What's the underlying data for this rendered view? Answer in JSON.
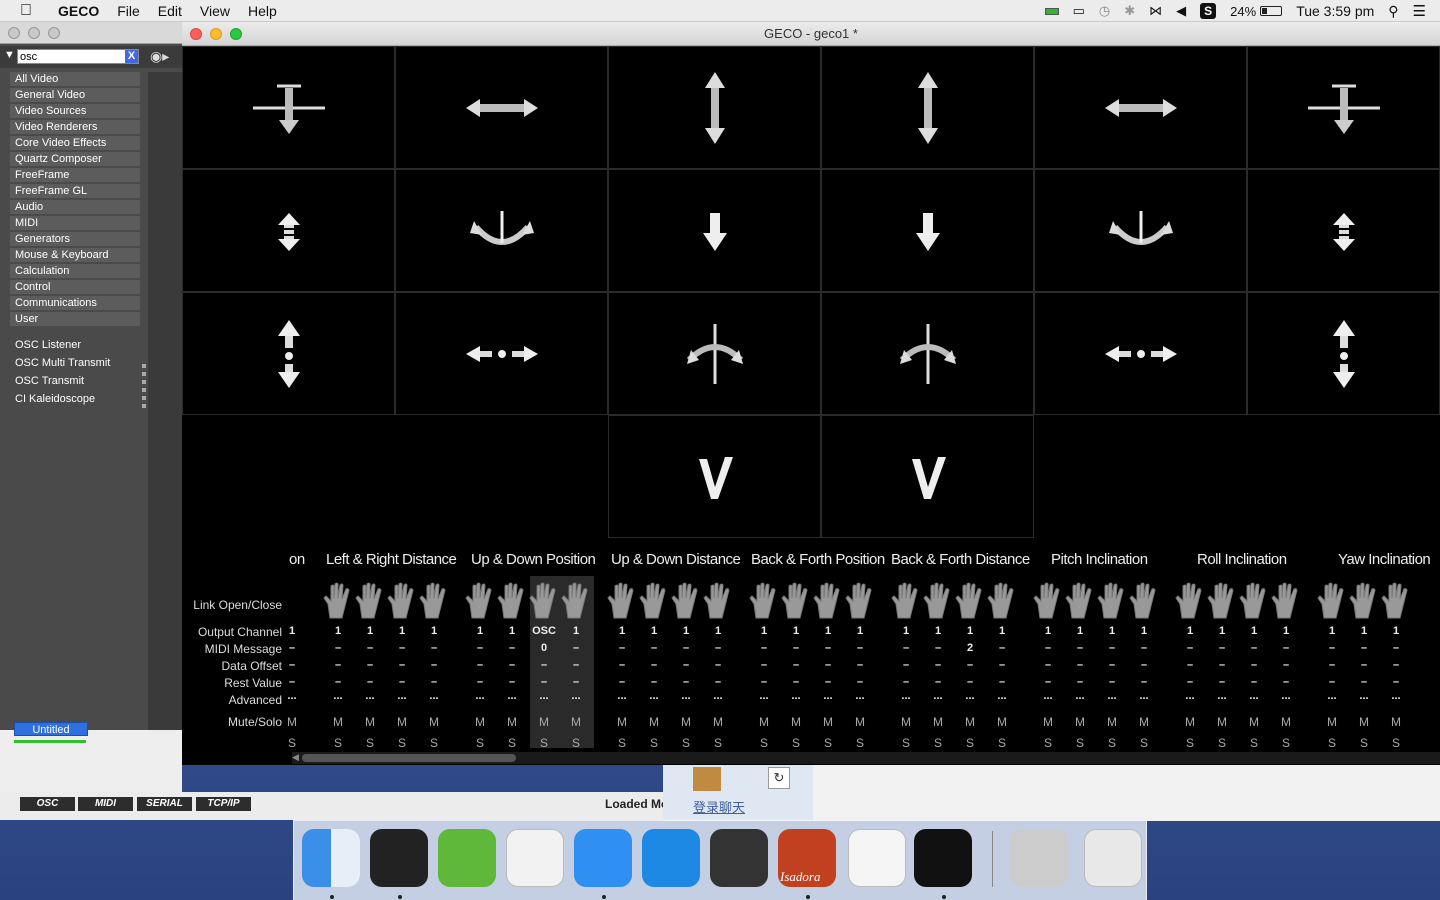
{
  "menubar": {
    "app_name": "GECO",
    "menus": [
      "File",
      "Edit",
      "View",
      "Help"
    ],
    "battery": "24%",
    "clock": "Tue 3:59 pm"
  },
  "left_panel": {
    "search_value": "osc",
    "search_clear": "X",
    "categories": [
      "All Video",
      "General Video",
      "Video Sources",
      "Video Renderers",
      "Core Video Effects",
      "Quartz Composer",
      "FreeFrame",
      "FreeFrame GL",
      "Audio",
      "MIDI",
      "Generators",
      "Mouse & Keyboard",
      "Calculation",
      "Control",
      "Communications",
      "User"
    ],
    "actors": [
      "OSC Listener",
      "OSC Multi Transmit",
      "OSC Transmit",
      "CI Kaleidoscope"
    ],
    "scene_name": "Untitled"
  },
  "statusbar": {
    "protocols": [
      "OSC",
      "MIDI",
      "SERIAL",
      "TCP/IP"
    ],
    "loaded_text": "Loaded Me",
    "chat_text": "登录聊天"
  },
  "main_window": {
    "title": "GECO - geco1 *"
  },
  "grid": {
    "icons": [
      [
        "cross-arrow",
        "horizontal-arrow",
        "vertical-arrow",
        "vertical-arrow",
        "horizontal-arrow",
        "cross-arrow"
      ],
      [
        "short-vertical-arrow",
        "roll-arc",
        "down-arrow",
        "down-arrow",
        "roll-arc",
        "short-vertical-arrow"
      ],
      [
        "vertical-dot-arrow",
        "horizontal-dot-arrow",
        "pitch-arc",
        "pitch-arc",
        "horizontal-dot-arrow",
        "vertical-dot-arrow"
      ],
      [
        "",
        "",
        "check",
        "check",
        "",
        ""
      ]
    ]
  },
  "controls": {
    "headers": [
      "on",
      "Left & Right Distance",
      "Up & Down Position",
      "Up & Down Distance",
      "Back & Forth Position",
      "Back & Forth Distance",
      "Pitch Inclination",
      "Roll Inclination",
      "Yaw Inclination"
    ],
    "row_labels": {
      "link": "Link Open/Close",
      "output": "Output Channel",
      "midi": "MIDI Message",
      "offset": "Data Offset",
      "rest": "Rest Value",
      "advanced": "Advanced",
      "mute": "Mute/Solo"
    },
    "selected_output": "OSC",
    "selected_midi": "0",
    "special_midi": "2",
    "channel_value": "1",
    "dash": "–",
    "dots": "...",
    "mute": "M",
    "solo": "S"
  },
  "dock": {
    "apps": [
      "Finder",
      "Unity",
      "Chronosync",
      "Slack",
      "Safari",
      "Word",
      "Geco",
      "Isadora",
      "Visual Studio",
      "Growl",
      "Unity Project",
      "Trash"
    ],
    "isadora_label": "Isadora"
  }
}
